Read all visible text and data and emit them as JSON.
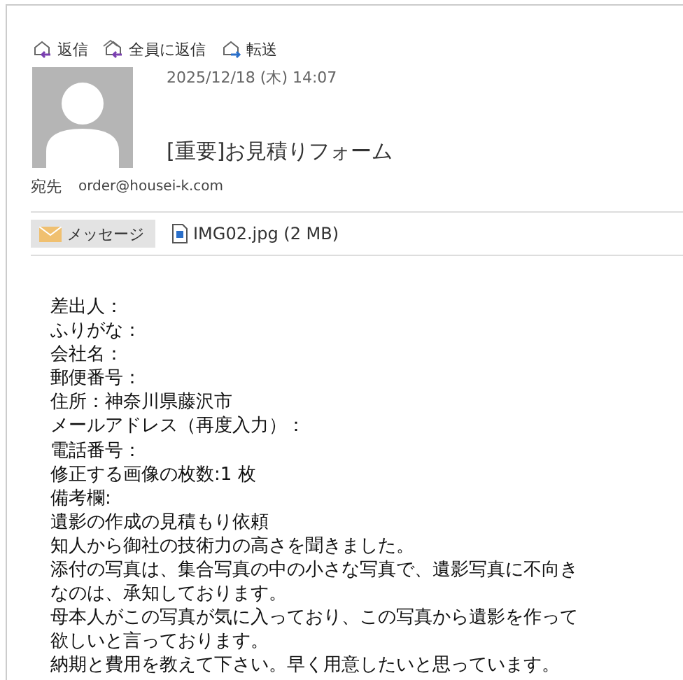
{
  "actions": [
    {
      "label": "返信",
      "kind": "reply"
    },
    {
      "label": "全員に返信",
      "kind": "reply-all"
    },
    {
      "label": "転送",
      "kind": "forward"
    }
  ],
  "message": {
    "date": "2025/12/18 (木) 14:07",
    "subject": "[重要]お見積りフォーム",
    "to_label": "宛先",
    "to": "order@housei-k.com"
  },
  "tabs": [
    {
      "label": "メッセージ",
      "kind": "message",
      "selected": true
    },
    {
      "label": "IMG02.jpg (2 MB)",
      "kind": "file",
      "selected": false
    }
  ],
  "body": [
    "差出人：",
    "ふりがな：",
    "会社名：",
    "郵便番号：",
    "住所：神奈川県藤沢市",
    "メールアドレス（再度入力）：",
    "電話番号：",
    "修正する画像の枚数:1 枚",
    "備考欄:",
    "遺影の作成の見積もり依頼",
    "知人から御社の技術力の高さを聞きました。",
    "添付の写真は、集合写真の中の小さな写真で、遺影写真に不向き",
    "なのは、承知しております。",
    "母本人がこの写真が気に入っており、この写真から遺影を作って",
    "欲しいと言っております。",
    "納期と費用を教えて下さい。早く用意したいと思っています。"
  ]
}
